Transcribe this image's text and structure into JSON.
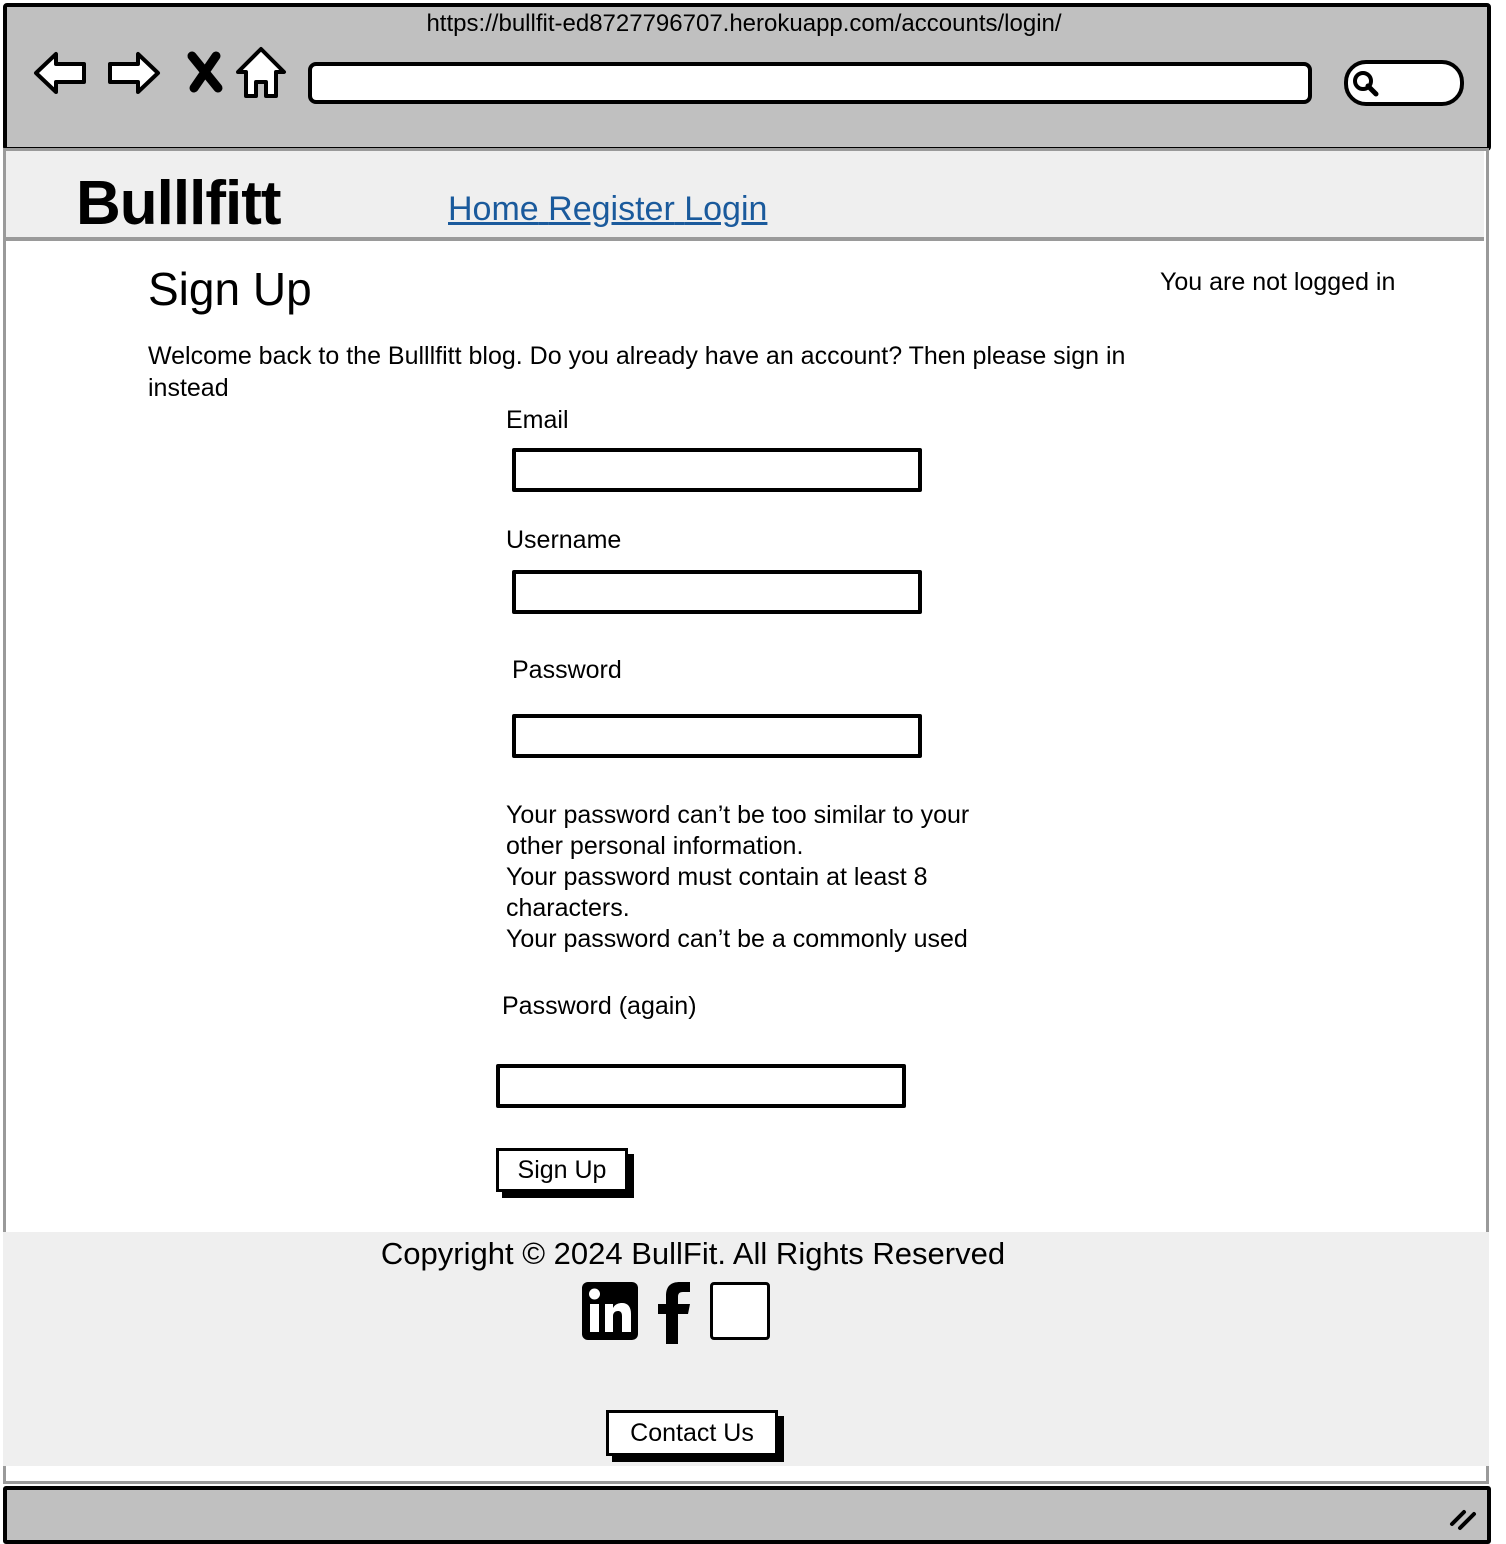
{
  "browser": {
    "url": "https://bullfit-ed8727796707.herokuapp.com/accounts/login/",
    "icons": [
      "back-arrow-icon",
      "forward-arrow-icon",
      "close-x-icon",
      "home-icon",
      "search-icon"
    ]
  },
  "header": {
    "brand": "Bulllfitt",
    "nav": [
      {
        "label": "Home"
      },
      {
        "label": "Register"
      },
      {
        "label": "Login"
      }
    ],
    "link_color": "#1a5a9c"
  },
  "main": {
    "title": "Sign Up",
    "status": "You are not logged in",
    "welcome": "Welcome back to the Bulllfitt blog. Do you already have an account? Then please sign in instead",
    "fields": {
      "email_label": "Email",
      "username_label": "Username",
      "password_label": "Password",
      "password_again_label": "Password (again)"
    },
    "password_help": [
      "Your password can’t be too similar to your other personal information.",
      "Your password must contain at least 8 characters.",
      "Your password can’t be a commonly used"
    ],
    "submit_label": "Sign Up"
  },
  "footer": {
    "copyright": "Copyright © 2024 BullFit. All Rights Reserved",
    "social_icons": [
      "linkedin-icon",
      "facebook-icon",
      "instagram-icon"
    ],
    "contact_label": "Contact Us"
  },
  "colors": {
    "chrome_bg": "#c0c0c0",
    "header_bg": "#efefef",
    "frame_border": "#9a9a9a"
  }
}
